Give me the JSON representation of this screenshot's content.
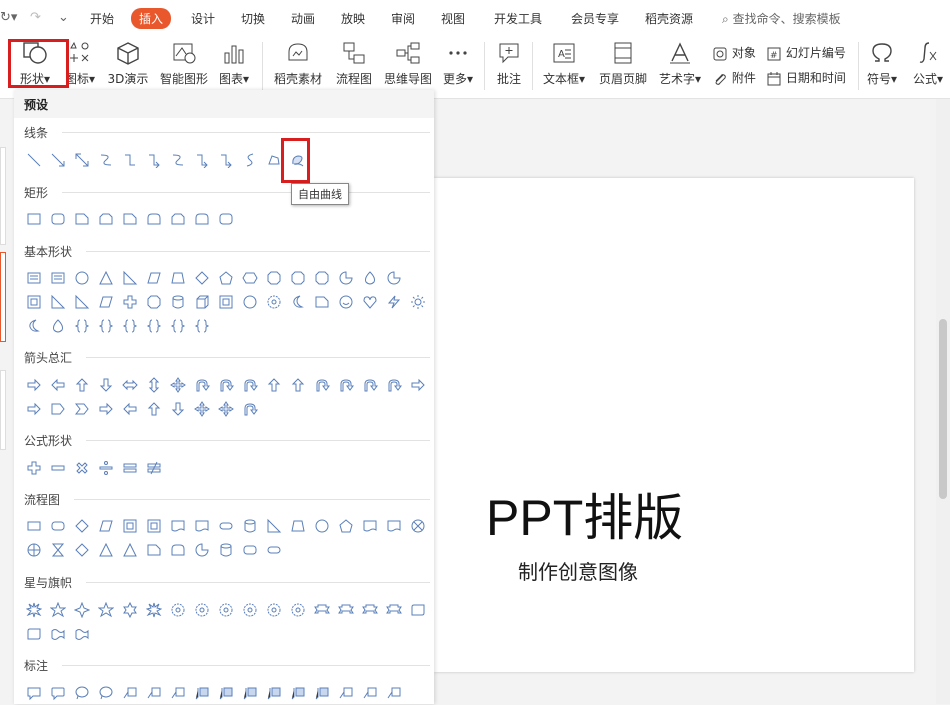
{
  "menubar": {
    "items": [
      "开始",
      "插入",
      "设计",
      "切换",
      "动画",
      "放映",
      "审阅",
      "视图",
      "开发工具",
      "会员专享",
      "稻壳资源"
    ],
    "active": "插入",
    "search": "查找命令、搜索模板"
  },
  "ribbon": {
    "buttons": [
      "形状",
      "图标",
      "3D演示",
      "智能图形",
      "图表",
      "稻壳素材",
      "流程图",
      "思维导图",
      "更多",
      "批注",
      "文本框",
      "页眉页脚",
      "艺术字",
      "符号",
      "公式"
    ],
    "small": [
      "对象",
      "幻灯片编号",
      "附件",
      "日期和时间"
    ]
  },
  "panel": {
    "title": "预设",
    "categories": [
      "线条",
      "矩形",
      "基本形状",
      "箭头总汇",
      "公式形状",
      "流程图",
      "星与旗帜",
      "标注"
    ],
    "tooltip": "自由曲线"
  },
  "slide": {
    "title": "PPT排版",
    "subtitle": "制作创意图像"
  },
  "colors": {
    "accent": "#e8582c",
    "highlight": "#d81e1e",
    "shape_stroke": "#5a7fb8"
  }
}
